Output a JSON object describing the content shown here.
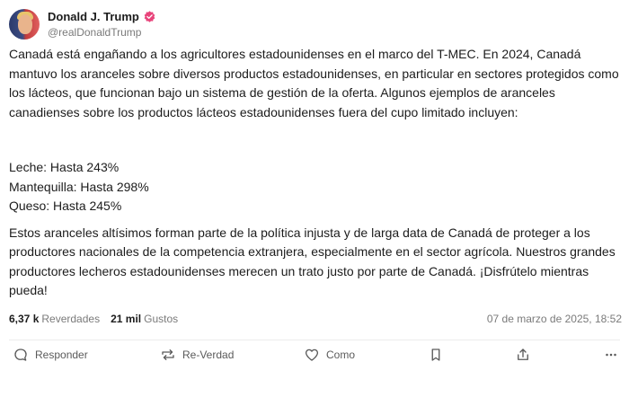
{
  "author": {
    "display_name": "Donald J. Trump",
    "handle": "@realDonaldTrump",
    "verified_color": "#e8437a",
    "avatar_icon": "avatar"
  },
  "post": {
    "paragraph1": "Canadá está engañando a los agricultores estadounidenses en el marco del T-MEC. En 2024, Canadá mantuvo los aranceles sobre diversos productos estadounidenses, en particular en sectores protegidos como los lácteos, que funcionan bajo un sistema de gestión de la oferta. Algunos ejemplos de aranceles canadienses sobre los productos lácteos estadounidenses fuera del cupo limitado incluyen:",
    "list": [
      "Leche: Hasta 243%",
      "Mantequilla: Hasta 298%",
      "Queso: Hasta 245%"
    ],
    "paragraph3": "Estos aranceles altísimos forman parte de la política injusta y de larga data de Canadá de proteger a los productores nacionales de la competencia extranjera, especialmente en el sector agrícola. Nuestros grandes productores lecheros estadounidenses merecen un trato justo por parte de Canadá. ¡Disfrútelo mientras pueda!"
  },
  "stats": {
    "retruths_count": "6,37 k",
    "retruths_label": "Reverdades",
    "likes_count": "21 mil",
    "likes_label": "Gustos",
    "timestamp": "07 de marzo de 2025, 18:52"
  },
  "actions": {
    "reply": "Responder",
    "retruth": "Re-Verdad",
    "like": "Como",
    "icons": [
      "reply-icon",
      "retruth-icon",
      "heart-icon",
      "bookmark-icon",
      "share-icon",
      "more-icon"
    ]
  }
}
